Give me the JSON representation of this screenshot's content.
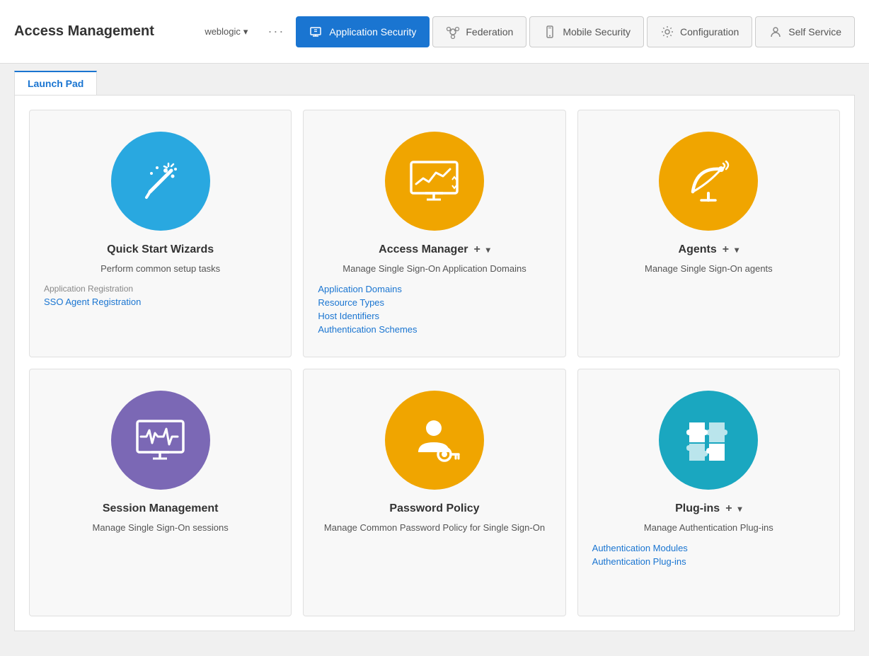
{
  "app": {
    "title": "Access Management"
  },
  "topbar": {
    "user": "weblogic",
    "dropdown_char": "▾",
    "dots": "···"
  },
  "nav": {
    "tabs": [
      {
        "id": "app-security",
        "label": "Application Security",
        "active": true,
        "icon": "app-security-icon"
      },
      {
        "id": "federation",
        "label": "Federation",
        "active": false,
        "icon": "federation-icon"
      },
      {
        "id": "mobile-security",
        "label": "Mobile Security",
        "active": false,
        "icon": "mobile-icon"
      },
      {
        "id": "configuration",
        "label": "Configuration",
        "active": false,
        "icon": "config-icon"
      },
      {
        "id": "self-service",
        "label": "Self Service",
        "active": false,
        "icon": "self-service-icon"
      }
    ]
  },
  "launchpad": {
    "tab_label": "Launch Pad"
  },
  "cards": [
    {
      "id": "quick-start",
      "title": "Quick Start Wizards",
      "color": "blue",
      "icon": "wand-icon",
      "description": "Perform common setup tasks",
      "section_label": "Application Registration",
      "links": [
        "SSO Agent Registration"
      ]
    },
    {
      "id": "access-manager",
      "title": "Access Manager",
      "color": "orange",
      "icon": "monitor-chart-icon",
      "description": "Manage Single Sign-On Application Domains",
      "section_label": "",
      "links": [
        "Application Domains",
        "Resource Types",
        "Host Identifiers",
        "Authentication Schemes"
      ],
      "has_add": true,
      "has_dropdown": true
    },
    {
      "id": "agents",
      "title": "Agents",
      "color": "orange",
      "icon": "satellite-icon",
      "description": "Manage Single Sign-On agents",
      "section_label": "",
      "links": [],
      "has_add": true,
      "has_dropdown": true
    },
    {
      "id": "session-management",
      "title": "Session Management",
      "color": "purple",
      "icon": "monitor-wave-icon",
      "description": "Manage Single Sign-On sessions",
      "section_label": "",
      "links": []
    },
    {
      "id": "password-policy",
      "title": "Password Policy",
      "color": "orange",
      "icon": "person-key-icon",
      "description": "Manage Common Password Policy for Single Sign-On",
      "section_label": "",
      "links": []
    },
    {
      "id": "plugins",
      "title": "Plug-ins",
      "color": "cyan",
      "icon": "puzzle-icon",
      "description": "Manage Authentication Plug-ins",
      "section_label": "",
      "links": [
        "Authentication Modules",
        "Authentication Plug-ins"
      ],
      "has_add": true,
      "has_dropdown": true
    }
  ]
}
